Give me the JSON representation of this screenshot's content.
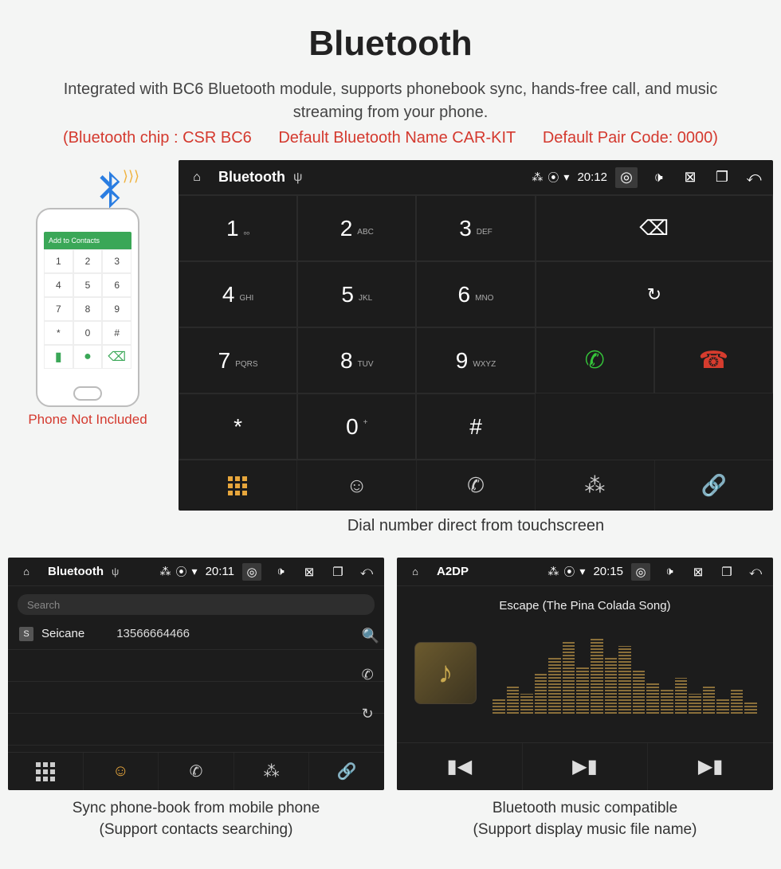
{
  "header": {
    "title": "Bluetooth",
    "description": "Integrated with BC6 Bluetooth module, supports phonebook sync, hands-free call, and music streaming from your phone.",
    "spec_chip": "(Bluetooth chip : CSR BC6",
    "spec_name": "Default Bluetooth Name CAR-KIT",
    "spec_code": "Default Pair Code: 0000)"
  },
  "phone": {
    "not_included": "Phone Not Included",
    "add_contacts": "Add to Contacts"
  },
  "dialer": {
    "statusbar": {
      "title": "Bluetooth",
      "time": "20:12"
    },
    "keys": [
      {
        "n": "1",
        "s": "ₒₒ"
      },
      {
        "n": "2",
        "s": "ABC"
      },
      {
        "n": "3",
        "s": "DEF"
      },
      {
        "n": "4",
        "s": "GHI"
      },
      {
        "n": "5",
        "s": "JKL"
      },
      {
        "n": "6",
        "s": "MNO"
      },
      {
        "n": "7",
        "s": "PQRS"
      },
      {
        "n": "8",
        "s": "TUV"
      },
      {
        "n": "9",
        "s": "WXYZ"
      },
      {
        "n": "*",
        "s": ""
      },
      {
        "n": "0",
        "s": "+"
      },
      {
        "n": "#",
        "s": ""
      }
    ],
    "caption": "Dial number direct from touchscreen"
  },
  "contacts": {
    "statusbar": {
      "title": "Bluetooth",
      "time": "20:11"
    },
    "search_placeholder": "Search",
    "entry": {
      "badge": "S",
      "name": "Seicane",
      "number": "13566664466"
    },
    "caption_l1": "Sync phone-book from mobile phone",
    "caption_l2": "(Support contacts searching)"
  },
  "music": {
    "statusbar": {
      "title": "A2DP",
      "time": "20:15"
    },
    "song": "Escape (The Pina Colada Song)",
    "caption_l1": "Bluetooth music compatible",
    "caption_l2": "(Support display music file name)"
  }
}
